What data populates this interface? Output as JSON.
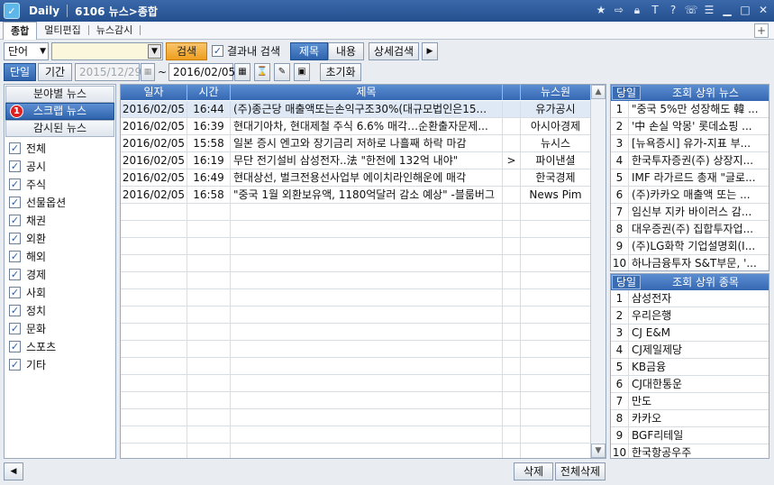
{
  "titlebar": {
    "app": "Daily",
    "title": "6106 뉴스>종합"
  },
  "tabs": [
    {
      "label": "종합"
    },
    {
      "label": "멀티편집"
    },
    {
      "label": "뉴스감시"
    }
  ],
  "toolbar1": {
    "search_type": "단어",
    "search_value": "",
    "search_btn": "검색",
    "within_results": "결과내 검색",
    "title_btn": "제목",
    "content_btn": "내용",
    "detail_btn": "상세검색"
  },
  "toolbar2": {
    "single_btn": "단일",
    "period_btn": "기간",
    "start_date": "2015/12/29",
    "tilde": "~",
    "end_date": "2016/02/05",
    "reset_btn": "초기화"
  },
  "left": {
    "btn_category": "분야별 뉴스",
    "btn_scrap": "스크랩 뉴스",
    "badge": "1",
    "btn_watched": "감시된 뉴스",
    "categories": [
      "전체",
      "공시",
      "주식",
      "선물옵션",
      "채권",
      "외환",
      "해외",
      "경제",
      "사회",
      "정치",
      "문화",
      "스포츠",
      "기타"
    ]
  },
  "grid": {
    "headers": [
      "일자",
      "시간",
      "제목",
      "뉴스원"
    ],
    "rows": [
      {
        "date": "2016/02/05",
        "time": "16:44",
        "title": "(주)종근당 매출액또는손익구조30%(대규모법인은15...",
        "marker": "",
        "source": "유가공시"
      },
      {
        "date": "2016/02/05",
        "time": "16:39",
        "title": "현대기아차, 현대제철 주식 6.6% 매각…순환출자문제...",
        "marker": "",
        "source": "아시아경제"
      },
      {
        "date": "2016/02/05",
        "time": "15:58",
        "title": "일본 증시 엔고와 장기금리 저하로 나흘째 하락 마감",
        "marker": "",
        "source": "뉴시스"
      },
      {
        "date": "2016/02/05",
        "time": "16:19",
        "title": "무단 전기설비 삼성전자..法 \"한전에 132억 내야\"",
        "marker": ">",
        "source": "파이낸셜"
      },
      {
        "date": "2016/02/05",
        "time": "16:49",
        "title": "현대상선, 벌크전용선사업부 에이치라인해운에 매각",
        "marker": "",
        "source": "한국경제"
      },
      {
        "date": "2016/02/05",
        "time": "16:58",
        "title": "\"중국 1월 외환보유액, 1180억달러 감소 예상\" -블룸버그",
        "marker": "",
        "source": "News Pim"
      }
    ]
  },
  "news_rank": {
    "tab": "당일",
    "title": "조회 상위 뉴스",
    "items": [
      "\"중국 5%만 성장해도 韓 ...",
      "'中 손실 악몽' 롯데쇼핑 ...",
      "[뉴욕증시] 유가-지표 부...",
      "한국투자증권(주) 상장지...",
      "IMF 라가르드 총재 \"글로...",
      "(주)카카오 매출액 또는 ...",
      "임신부 지카 바이러스 감...",
      "대우증권(주) 집합투자업...",
      "(주)LG화학 기업설명회(I...",
      "하나금융투자 S&T부문, '..."
    ]
  },
  "stock_rank": {
    "tab": "당일",
    "title": "조회 상위 종목",
    "items": [
      "삼성전자",
      "우리은행",
      "CJ E&M",
      "CJ제일제당",
      "KB금융",
      "CJ대한통운",
      "만도",
      "카카오",
      "BGF리테일",
      "한국항공우주"
    ]
  },
  "bottom": {
    "delete_btn": "삭제",
    "delete_all_btn": "전체삭제"
  }
}
